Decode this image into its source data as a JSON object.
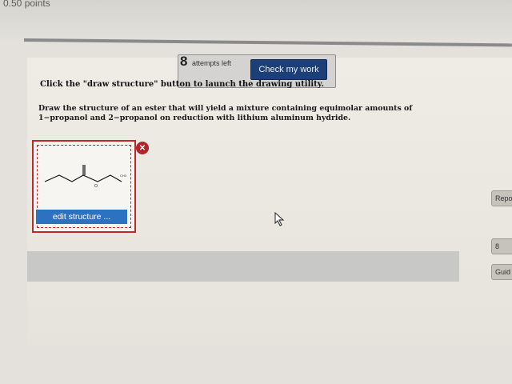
{
  "header": {
    "points": "0.50 points"
  },
  "attempts": {
    "count": "8",
    "label": "attempts left"
  },
  "check_button": "Check my work",
  "instruction": "Click the \"draw structure\" button to launch the drawing utility.",
  "question": "Draw the structure of an ester that will yield a mixture containing equimolar amounts of 1−propanol and 2−propanol on reduction with lithium aluminum hydride.",
  "structure": {
    "edit_label": "edit structure ...",
    "remove_icon": "close-icon",
    "atom_O": "O",
    "atom_CH3": "CH3"
  },
  "side": {
    "report_label": "Repo",
    "small_label": "8",
    "guide_label": "Guid"
  }
}
